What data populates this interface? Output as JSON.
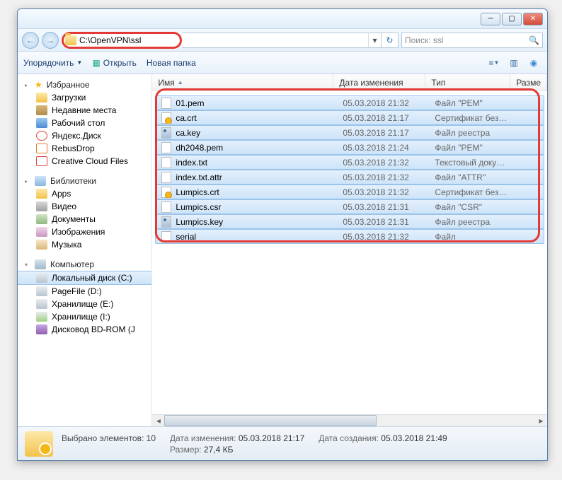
{
  "address": {
    "path": "C:\\OpenVPN\\ssl"
  },
  "search": {
    "placeholder": "Поиск: ssl"
  },
  "toolbar": {
    "organize": "Упорядочить",
    "open": "Открыть",
    "newfolder": "Новая папка"
  },
  "columns": {
    "name": "Имя",
    "date": "Дата изменения",
    "type": "Тип",
    "size": "Разме"
  },
  "sidebar": {
    "favorites": {
      "title": "Избранное",
      "items": [
        {
          "label": "Загрузки",
          "icon": "dl"
        },
        {
          "label": "Недавние места",
          "icon": "recent"
        },
        {
          "label": "Рабочий стол",
          "icon": "desk"
        },
        {
          "label": "Яндекс.Диск",
          "icon": "yadisk"
        },
        {
          "label": "RebusDrop",
          "icon": "rebus"
        },
        {
          "label": "Creative Cloud Files",
          "icon": "cc"
        }
      ]
    },
    "libraries": {
      "title": "Библиотеки",
      "items": [
        {
          "label": "Apps",
          "icon": "libapps"
        },
        {
          "label": "Видео",
          "icon": "libvid"
        },
        {
          "label": "Документы",
          "icon": "libdoc"
        },
        {
          "label": "Изображения",
          "icon": "libimg"
        },
        {
          "label": "Музыка",
          "icon": "libmus"
        }
      ]
    },
    "computer": {
      "title": "Компьютер",
      "items": [
        {
          "label": "Локальный диск (C:)",
          "icon": "drive",
          "sel": true
        },
        {
          "label": "PageFile (D:)",
          "icon": "drive"
        },
        {
          "label": "Хранилище (E:)",
          "icon": "drive"
        },
        {
          "label": "Хранилище (I:)",
          "icon": "driveusb"
        },
        {
          "label": "Дисковод BD-ROM (J",
          "icon": "bdrom"
        }
      ]
    }
  },
  "files": [
    {
      "name": "01.pem",
      "date": "05.03.2018 21:32",
      "type": "Файл \"PEM\"",
      "icon": ""
    },
    {
      "name": "ca.crt",
      "date": "05.03.2018 21:17",
      "type": "Сертификат безо...",
      "icon": "fi-cert"
    },
    {
      "name": "ca.key",
      "date": "05.03.2018 21:17",
      "type": "Файл реестра",
      "icon": "fi-key"
    },
    {
      "name": "dh2048.pem",
      "date": "05.03.2018 21:24",
      "type": "Файл \"PEM\"",
      "icon": ""
    },
    {
      "name": "index.txt",
      "date": "05.03.2018 21:32",
      "type": "Текстовый докум...",
      "icon": ""
    },
    {
      "name": "index.txt.attr",
      "date": "05.03.2018 21:32",
      "type": "Файл \"ATTR\"",
      "icon": ""
    },
    {
      "name": "Lumpics.crt",
      "date": "05.03.2018 21:32",
      "type": "Сертификат безо...",
      "icon": "fi-cert"
    },
    {
      "name": "Lumpics.csr",
      "date": "05.03.2018 21:31",
      "type": "Файл \"CSR\"",
      "icon": ""
    },
    {
      "name": "Lumpics.key",
      "date": "05.03.2018 21:31",
      "type": "Файл реестра",
      "icon": "fi-key"
    },
    {
      "name": "serial",
      "date": "05.03.2018 21:32",
      "type": "Файл",
      "icon": ""
    }
  ],
  "status": {
    "selection": "Выбрано элементов: 10",
    "modlabel": "Дата изменения:",
    "modval": "05.03.2018 21:17",
    "sizelabel": "Размер:",
    "sizeval": "27,4 КБ",
    "createlabel": "Дата создания:",
    "createval": "05.03.2018 21:49"
  }
}
